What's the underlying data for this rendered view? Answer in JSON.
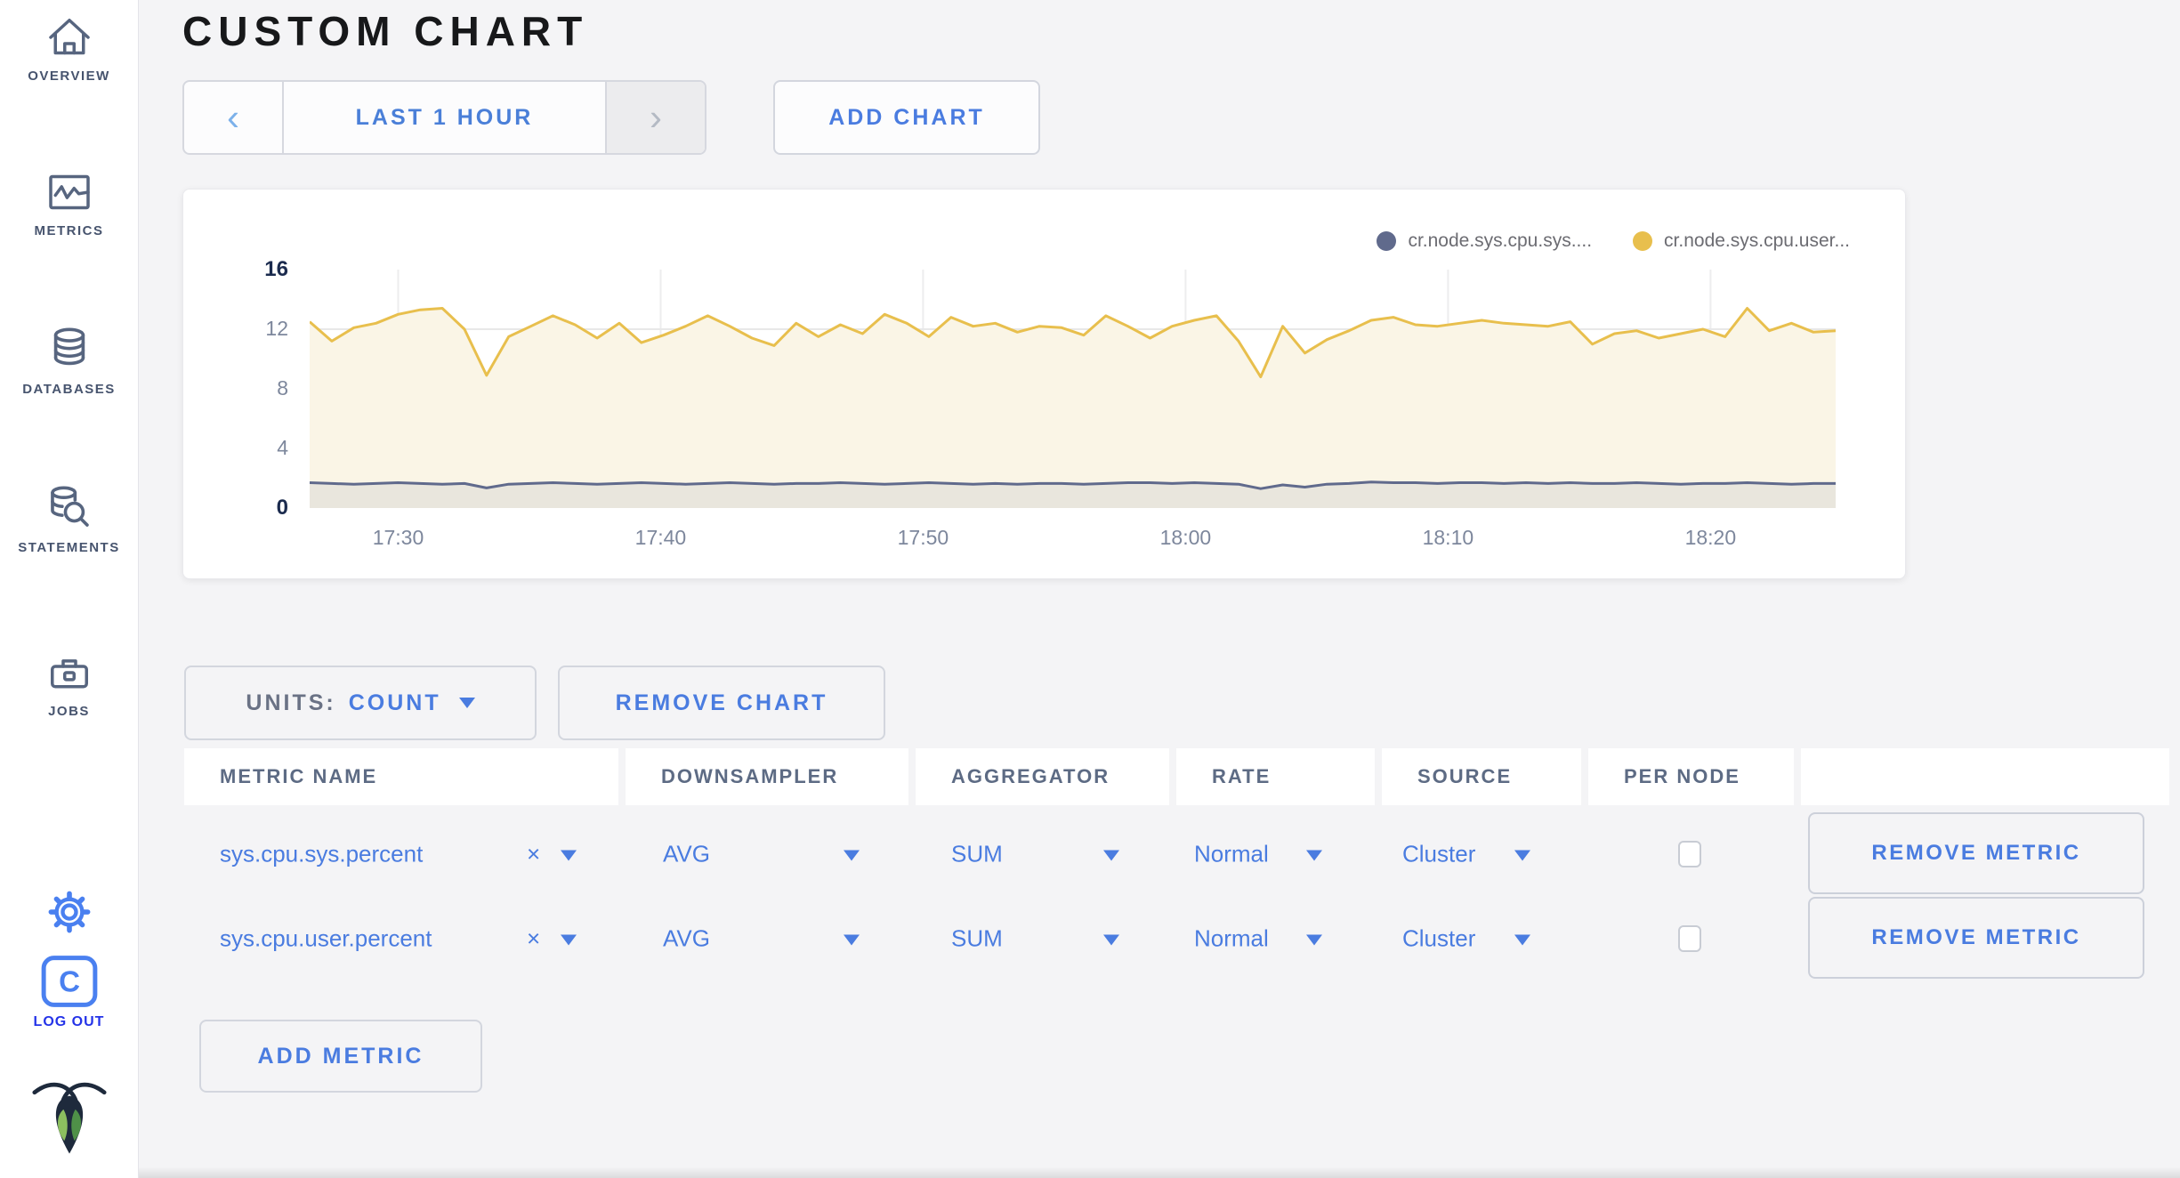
{
  "sidebar": {
    "items": [
      {
        "label": "OVERVIEW"
      },
      {
        "label": "METRICS"
      },
      {
        "label": "DATABASES"
      },
      {
        "label": "STATEMENTS"
      },
      {
        "label": "JOBS"
      }
    ],
    "logout_label": "LOG OUT",
    "logout_icon_letter": "C"
  },
  "header": {
    "title": "CUSTOM CHART",
    "time_range_label": "LAST 1 HOUR",
    "add_chart_label": "ADD CHART"
  },
  "icons": {
    "chevron_left": "‹",
    "chevron_right": "›"
  },
  "chart_controls": {
    "units_label": "UNITS:",
    "units_value": "COUNT",
    "remove_chart_label": "REMOVE CHART",
    "add_metric_label": "ADD METRIC",
    "remove_metric_label": "REMOVE METRIC"
  },
  "metrics_table": {
    "headers": [
      "METRIC NAME",
      "DOWNSAMPLER",
      "AGGREGATOR",
      "RATE",
      "SOURCE",
      "PER NODE"
    ],
    "rows": [
      {
        "name": "sys.cpu.sys.percent",
        "remove_symbol": "×",
        "downsampler": "AVG",
        "aggregator": "SUM",
        "rate": "Normal",
        "source": "Cluster",
        "per_node_checked": false
      },
      {
        "name": "sys.cpu.user.percent",
        "remove_symbol": "×",
        "downsampler": "AVG",
        "aggregator": "SUM",
        "rate": "Normal",
        "source": "Cluster",
        "per_node_checked": false
      }
    ]
  },
  "chart_data": {
    "type": "line",
    "title": "",
    "xlabel": "",
    "ylabel": "",
    "ylim": [
      0,
      16
    ],
    "y_ticks": [
      0,
      4,
      8,
      12,
      16
    ],
    "x_ticks": [
      "17:30",
      "17:40",
      "17:50",
      "18:00",
      "18:10",
      "18:20"
    ],
    "x_tick_fractions": [
      0.058,
      0.23,
      0.402,
      0.574,
      0.746,
      0.918
    ],
    "grid": true,
    "legend_position": "top-right",
    "series": [
      {
        "name": "cr.node.sys.cpu.sys....",
        "color": "#606a8c",
        "fill": "#e9e6dd",
        "values": [
          1.7,
          1.65,
          1.6,
          1.65,
          1.7,
          1.65,
          1.6,
          1.65,
          1.35,
          1.6,
          1.65,
          1.7,
          1.65,
          1.6,
          1.65,
          1.7,
          1.65,
          1.6,
          1.65,
          1.7,
          1.65,
          1.6,
          1.65,
          1.65,
          1.7,
          1.65,
          1.6,
          1.65,
          1.7,
          1.65,
          1.6,
          1.65,
          1.6,
          1.65,
          1.65,
          1.6,
          1.65,
          1.7,
          1.7,
          1.65,
          1.7,
          1.65,
          1.6,
          1.3,
          1.55,
          1.4,
          1.6,
          1.65,
          1.75,
          1.7,
          1.7,
          1.65,
          1.7,
          1.7,
          1.65,
          1.7,
          1.65,
          1.7,
          1.65,
          1.65,
          1.7,
          1.65,
          1.6,
          1.65,
          1.65,
          1.7,
          1.65,
          1.6,
          1.65,
          1.65
        ]
      },
      {
        "name": "cr.node.sys.cpu.user...",
        "color": "#e8bf4d",
        "fill": "#faf5e6",
        "values": [
          12.5,
          11.2,
          12.1,
          12.4,
          13.0,
          13.3,
          13.4,
          12.0,
          8.9,
          11.5,
          12.2,
          12.9,
          12.3,
          11.4,
          12.4,
          11.1,
          11.6,
          12.2,
          12.9,
          12.2,
          11.4,
          10.9,
          12.4,
          11.5,
          12.3,
          11.7,
          13.0,
          12.4,
          11.5,
          12.8,
          12.2,
          12.4,
          11.8,
          12.2,
          12.1,
          11.6,
          12.9,
          12.2,
          11.4,
          12.2,
          12.6,
          12.9,
          11.2,
          8.8,
          12.2,
          10.4,
          11.3,
          11.9,
          12.6,
          12.8,
          12.3,
          12.2,
          12.4,
          12.6,
          12.4,
          12.3,
          12.2,
          12.5,
          11.0,
          11.7,
          11.9,
          11.4,
          11.7,
          12.0,
          11.5,
          13.4,
          11.9,
          12.4,
          11.8,
          11.9
        ]
      }
    ]
  }
}
